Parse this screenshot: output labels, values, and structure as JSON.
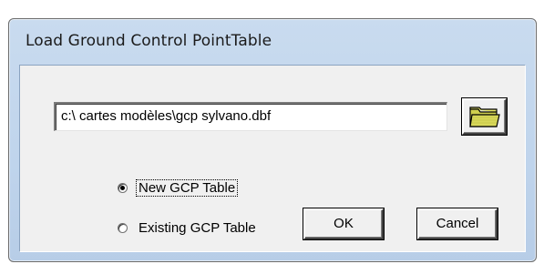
{
  "dialog": {
    "title": "Load Ground Control PointTable"
  },
  "path_field": {
    "value": "c:\\ cartes modèles\\gcp sylvano.dbf"
  },
  "browse_button": {
    "icon": "folder-icon",
    "icon_color": "#d4d45a"
  },
  "options": {
    "new_table_label": "New GCP Table",
    "new_table_selected": true,
    "existing_table_label": "Existing GCP Table",
    "existing_table_selected": false
  },
  "buttons": {
    "ok_label": "OK",
    "cancel_label": "Cancel"
  },
  "colors": {
    "frame": "#bfd4ec",
    "client": "#f0f0f0"
  }
}
